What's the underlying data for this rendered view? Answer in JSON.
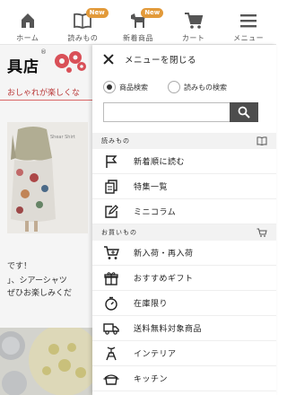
{
  "nav": {
    "items": [
      {
        "label": "ホーム",
        "icon": "home-icon"
      },
      {
        "label": "読みもの",
        "icon": "book-icon",
        "badge": "New"
      },
      {
        "label": "新着商品",
        "icon": "dala-horse-icon",
        "badge": "New"
      },
      {
        "label": "カート",
        "icon": "cart-icon"
      },
      {
        "label": "メニュー",
        "icon": "hamburger-icon"
      }
    ]
  },
  "background_page": {
    "shop_name": "具店",
    "registered_mark": "®",
    "tagline": "おしゃれが楽しくな",
    "photo_caption": "Shear Shirt",
    "text_lines": [
      "です！",
      "」、シアーシャツ",
      "ぜひお楽しみくだ"
    ]
  },
  "menu": {
    "close_label": "メニューを閉じる",
    "search": {
      "options": [
        {
          "label": "商品検索",
          "selected": true
        },
        {
          "label": "読みもの検索",
          "selected": false
        }
      ],
      "value": ""
    },
    "sections": [
      {
        "title": "読みもの",
        "icon": "book-icon",
        "items": [
          {
            "label": "新着順に読む",
            "icon": "flag-icon"
          },
          {
            "label": "特集一覧",
            "icon": "documents-icon"
          },
          {
            "label": "ミニコラム",
            "icon": "edit-note-icon"
          }
        ]
      },
      {
        "title": "お買いもの",
        "icon": "cart-icon",
        "items": [
          {
            "label": "新入荷・再入荷",
            "icon": "new-cart-icon"
          },
          {
            "label": "おすすめギフト",
            "icon": "gift-icon"
          },
          {
            "label": "在庫限り",
            "icon": "timer-icon"
          },
          {
            "label": "送料無料対象商品",
            "icon": "delivery-truck-icon"
          },
          {
            "label": "インテリア",
            "icon": "chair-icon"
          },
          {
            "label": "キッチン",
            "icon": "pot-icon"
          }
        ]
      }
    ]
  },
  "colors": {
    "badge": "#e29a3a",
    "tagline": "#c23b3b",
    "search_button": "#4d4d4d",
    "section_bg": "#f2f2f2"
  }
}
